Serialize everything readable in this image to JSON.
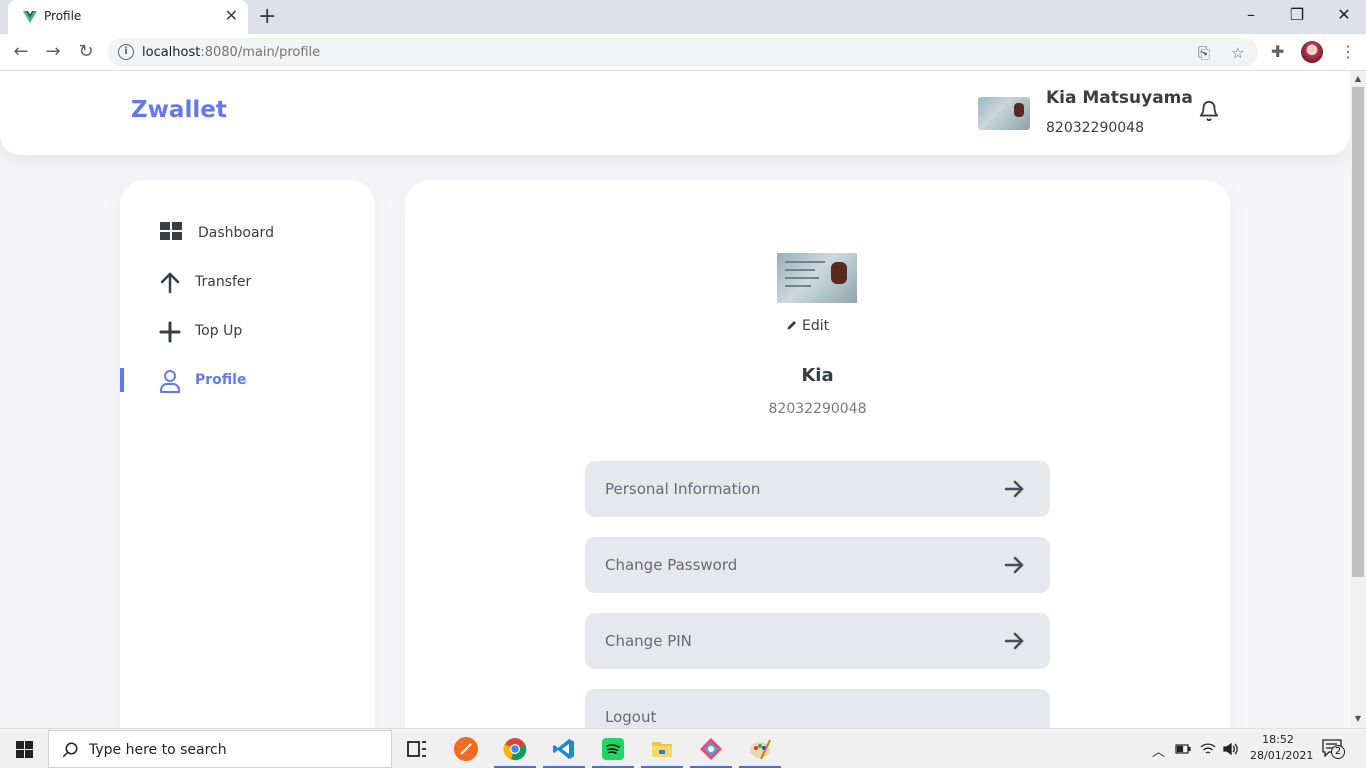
{
  "browser": {
    "tab_title": "Profile",
    "url_host": "localhost",
    "url_rest": ":8080/main/profile"
  },
  "header": {
    "brand": "Zwallet",
    "user_name": "Kia Matsuyama",
    "user_phone": "82032290048"
  },
  "sidebar": {
    "items": [
      {
        "label": "Dashboard",
        "icon": "dashboard-icon"
      },
      {
        "label": "Transfer",
        "icon": "arrow-up-icon"
      },
      {
        "label": "Top Up",
        "icon": "plus-icon"
      },
      {
        "label": "Profile",
        "icon": "user-icon",
        "active": true
      }
    ]
  },
  "profile": {
    "edit_label": "Edit",
    "name": "Kia",
    "phone": "82032290048",
    "menu": [
      {
        "label": "Personal Information"
      },
      {
        "label": "Change Password"
      },
      {
        "label": "Change PIN"
      },
      {
        "label": "Logout"
      }
    ]
  },
  "taskbar": {
    "search_placeholder": "Type here to search",
    "time": "18:52",
    "date": "28/01/2021",
    "notification_count": "2"
  },
  "colors": {
    "accent": "#6379f4",
    "button_bg": "#e5e8ed",
    "text_dark": "#3a3d42"
  }
}
